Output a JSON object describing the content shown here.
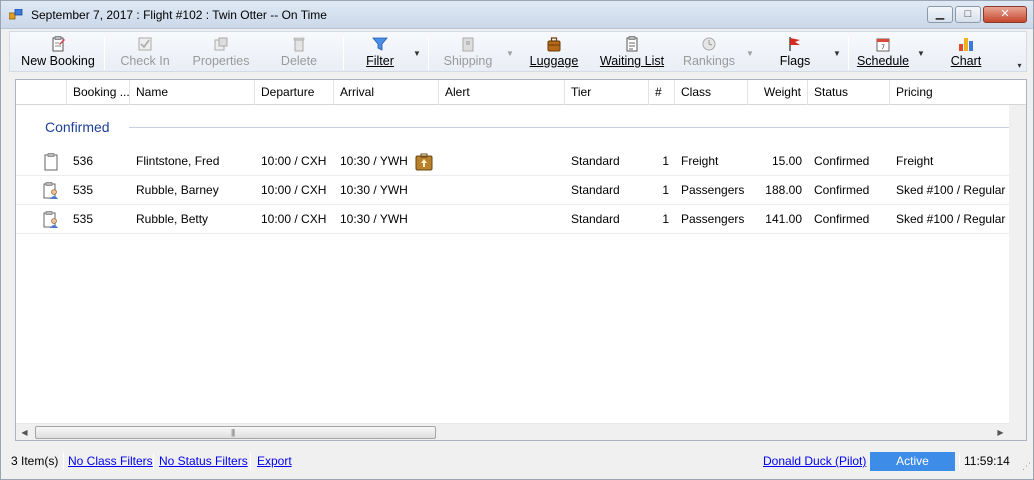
{
  "window": {
    "title": "September 7, 2017 : Flight #102 : Twin Otter -- On Time"
  },
  "toolbar": {
    "new_booking": "New Booking",
    "check_in": "Check In",
    "properties": "Properties",
    "delete": "Delete",
    "filter": "Filter",
    "shipping": "Shipping",
    "luggage": "Luggage",
    "waiting_list": "Waiting List",
    "rankings": "Rankings",
    "flags": "Flags",
    "schedule": "Schedule",
    "chart": "Chart"
  },
  "grid": {
    "columns": {
      "booking": "Booking ...",
      "name": "Name",
      "departure": "Departure",
      "arrival": "Arrival",
      "alert": "Alert",
      "tier": "Tier",
      "count": "#",
      "class": "Class",
      "weight": "Weight",
      "status": "Status",
      "pricing": "Pricing"
    },
    "group_label": "Confirmed",
    "rows": [
      {
        "icon": "clipboard-icon",
        "booking": "536",
        "name": "Flintstone, Fred",
        "departure": "10:00 / CXH",
        "arrival": "10:30 / YWH",
        "alert_icon": "luggage-alert-icon",
        "tier": "Standard",
        "count": "1",
        "class": "Freight",
        "weight": "15.00",
        "status": "Confirmed",
        "pricing": "Freight"
      },
      {
        "icon": "passenger-icon",
        "booking": "535",
        "name": "Rubble, Barney",
        "departure": "10:00 / CXH",
        "arrival": "10:30 / YWH",
        "alert_icon": "",
        "tier": "Standard",
        "count": "1",
        "class": "Passengers",
        "weight": "188.00",
        "status": "Confirmed",
        "pricing": "Sked #100 / Regular"
      },
      {
        "icon": "passenger-icon",
        "booking": "535",
        "name": "Rubble, Betty",
        "departure": "10:00 / CXH",
        "arrival": "10:30 / YWH",
        "alert_icon": "",
        "tier": "Standard",
        "count": "1",
        "class": "Passengers",
        "weight": "141.00",
        "status": "Confirmed",
        "pricing": "Sked #100 / Regular"
      }
    ]
  },
  "statusbar": {
    "items_count": "3 Item(s)",
    "class_filters": "No Class Filters",
    "status_filters": "No Status Filters",
    "export": "Export",
    "user": "Donald Duck (Pilot)",
    "state": "Active",
    "time": "11:59:14"
  },
  "colors": {
    "active_badge": "#3c8ce8",
    "group_label": "#1e3f9a",
    "link": "#0000ee"
  }
}
